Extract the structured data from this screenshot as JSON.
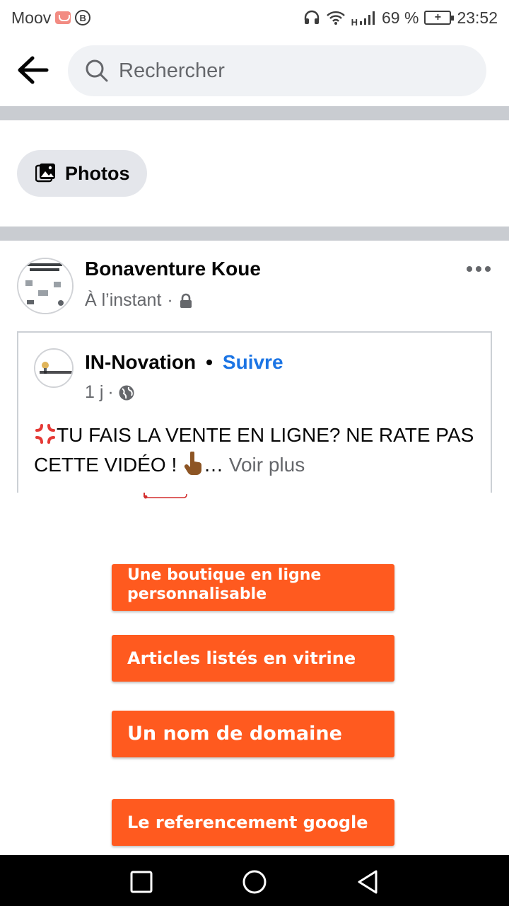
{
  "status_bar": {
    "carrier": "Moov",
    "battery": "69 %",
    "time": "23:52",
    "network": "H"
  },
  "search": {
    "placeholder": "Rechercher"
  },
  "filter_chip": {
    "label": "Photos"
  },
  "post": {
    "author": "Bonaventure Koue",
    "time": "À l’instant",
    "separator": "·"
  },
  "shared": {
    "page_name": "IN-Novation",
    "follow_separator": "•",
    "follow_label": "Suivre",
    "time": "1 j",
    "separator": "·",
    "text": "TU FAIS LA VENTE EN LIGNE? NE RATE PAS CETTE VIDÉO ! ",
    "ellipsis": "… ",
    "see_more": "Voir plus",
    "text_emoji_start": "anger-icon",
    "text_emoji_end": "pointing-hand-icon"
  },
  "video_features": [
    "Une boutique en ligne personnalisable",
    "Articles listés en vitrine",
    "Un nom de domaine",
    "Le referencement google"
  ],
  "colors": {
    "accent_blue": "#1b74e4",
    "feature_orange": "#ff5a1f",
    "divider": "#c9ccd1",
    "chip_bg": "#e4e6eb"
  }
}
